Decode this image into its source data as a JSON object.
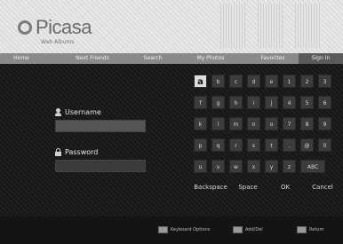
{
  "app": {
    "name": "Picasa",
    "tagline": "Web Albums"
  },
  "nav": {
    "items": [
      "Home",
      "Next Friends",
      "Search",
      "My Photos",
      "Favorites",
      "Sign In"
    ],
    "active_index": 5
  },
  "login": {
    "username_label": "Username",
    "password_label": "Password"
  },
  "keyboard": {
    "rows": [
      [
        "a",
        "b",
        "c",
        "d",
        "e",
        "1",
        "2",
        "3"
      ],
      [
        "f",
        "g",
        "h",
        "i",
        "j",
        "4",
        "5",
        "6"
      ],
      [
        "k",
        "l",
        "m",
        "n",
        "o",
        "7",
        "8",
        "9"
      ],
      [
        "p",
        "q",
        "r",
        "s",
        "t",
        ".",
        "@",
        "0"
      ],
      [
        "u",
        "v",
        "w",
        "x",
        "y",
        "z",
        "ABC"
      ]
    ],
    "actions": [
      "Backspace",
      "Space",
      "OK",
      "Cancel"
    ],
    "selected": "a"
  },
  "footer": {
    "items": [
      "Keyboard Options",
      "Add/Del",
      "Return"
    ]
  },
  "colors": {
    "background": "#1c1c1c",
    "header": "#e6e6e6",
    "nav_bar": "#8a8a8a",
    "key": "#3c3c3c",
    "selected_key": "#dcdcdc"
  }
}
